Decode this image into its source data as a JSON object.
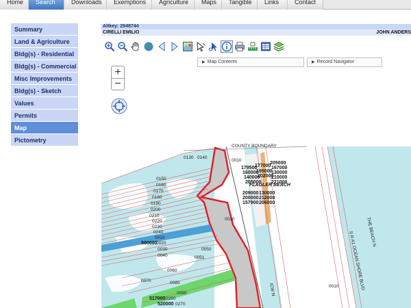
{
  "topnav": {
    "tabs": [
      {
        "label": "Home",
        "width": 42,
        "active": false
      },
      {
        "label": "Search",
        "width": 52,
        "active": true
      },
      {
        "label": "Downloads",
        "width": 62,
        "active": false
      },
      {
        "label": "Exemptions",
        "width": 66,
        "active": false
      },
      {
        "label": "Agriculture",
        "width": 62,
        "active": false
      },
      {
        "label": "Maps",
        "width": 40,
        "active": false
      },
      {
        "label": "Tangible",
        "width": 52,
        "active": false
      },
      {
        "label": "Links",
        "width": 44,
        "active": false
      },
      {
        "label": "Contact",
        "width": 52,
        "active": false
      }
    ]
  },
  "sidebar": {
    "items": [
      {
        "label": "Summary",
        "active": false
      },
      {
        "label": "Land & Agriculture",
        "active": false
      },
      {
        "label": "Bldg(s) - Residential",
        "active": false
      },
      {
        "label": "Bldg(s) - Commercial",
        "active": false
      },
      {
        "label": "Misc Improvements",
        "active": false
      },
      {
        "label": "Bldg(s) - Sketch",
        "active": false
      },
      {
        "label": "Values",
        "active": false
      },
      {
        "label": "Permits",
        "active": false
      },
      {
        "label": "Map",
        "active": true
      },
      {
        "label": "Pictometry",
        "active": false
      }
    ]
  },
  "header": {
    "altkey": "Altkey: 2948744",
    "owner1": "CIRELLI EMILIO",
    "owner2": "JOHN ANDERS"
  },
  "toolbar": {
    "tools": [
      "zoom-in-icon",
      "zoom-out-icon",
      "pan-hand-icon",
      "globe-icon",
      "back-icon",
      "forward-icon",
      "full-extent-icon",
      "select-arrow-icon",
      "identify-cursor-icon",
      "info-icon",
      "print-icon",
      "measure-icon",
      "table-icon",
      "layers-icon"
    ]
  },
  "panels": {
    "map_contents": "Map Contents",
    "record_navigator": "Record Navigator"
  },
  "zoom": {
    "plus": "+",
    "minus": "−"
  },
  "map": {
    "labels": {
      "county_boundary": "COUNTY BOUNDARY",
      "flagler_beach": "FLAGLER BEACH",
      "the_beach": "THE BEACH N",
      "ocean_shore": "S R A1 OCEAN SHORE BLVD",
      "icw": "ICW N"
    },
    "parcels": [
      "0010",
      "0130",
      "0140",
      "0150",
      "0160",
      "0170",
      "0180",
      "0190",
      "0200",
      "0210",
      "0220",
      "0230",
      "0240",
      "0010",
      "500000",
      "0020",
      "0030",
      "0040",
      "0050",
      "0051",
      "0060",
      "0070",
      "0080",
      "0090",
      "517000",
      "0250",
      "520000",
      "0270",
      "0010",
      "0010"
    ],
    "beach_numbers": [
      "205000",
      "177000",
      "167000",
      "179500",
      "195000",
      "130000",
      "160000",
      "202000",
      "210000",
      "140000",
      "205000",
      "221000",
      "209000",
      "130000",
      "200000",
      "212000",
      "157900",
      "206000"
    ]
  }
}
